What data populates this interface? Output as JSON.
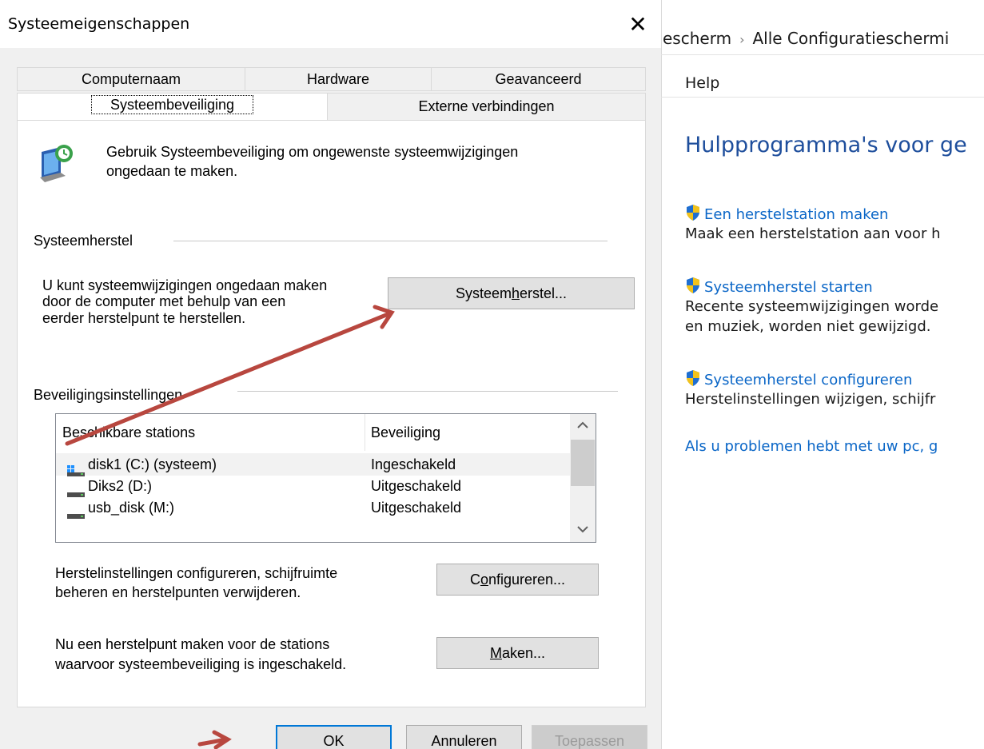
{
  "dialog": {
    "title": "Systeemeigenschappen",
    "close_glyph": "✕",
    "tabs_row1": [
      "Computernaam",
      "Hardware",
      "Geavanceerd"
    ],
    "tabs_row2": [
      "Systeembeveiliging",
      "Externe verbindingen"
    ],
    "intro_line1": "Gebruik Systeembeveiliging om ongewenste systeemwijzigingen",
    "intro_line2": "ongedaan te maken.",
    "restore_group": {
      "label": "Systeemherstel",
      "text_line1": "U kunt systeemwijzigingen ongedaan maken",
      "text_line2": "door de computer met behulp van een",
      "text_line3": "eerder herstelpunt te herstellen.",
      "button_pre": "Systeem",
      "button_accel": "h",
      "button_post": "erstel..."
    },
    "protection_group": {
      "label": "Beveiligingsinstellingen",
      "columns": [
        "Beschikbare stations",
        "Beveiliging"
      ],
      "rows": [
        {
          "name": "disk1 (C:) (systeem)",
          "status": "Ingeschakeld",
          "icon": "system-drive-icon"
        },
        {
          "name": "Diks2 (D:)",
          "status": "Uitgeschakeld",
          "icon": "drive-icon"
        },
        {
          "name": "usb_disk (M:)",
          "status": "Uitgeschakeld",
          "icon": "drive-icon"
        }
      ],
      "configure_text_line1": "Herstelinstellingen configureren, schijfruimte",
      "configure_text_line2": "beheren en herstelpunten verwijderen.",
      "configure_pre": "C",
      "configure_accel": "o",
      "configure_post": "nfigureren...",
      "create_text_line1": "Nu een herstelpunt maken voor de stations",
      "create_text_line2": "waarvoor systeembeveiliging is ingeschakeld.",
      "create_accel": "M",
      "create_post": "aken..."
    },
    "buttons": {
      "ok": "OK",
      "cancel": "Annuleren",
      "apply": "Toepassen"
    }
  },
  "control_panel": {
    "breadcrumb": [
      "escherm",
      "Alle Configuratieschermi"
    ],
    "breadcrumb_sep": "›",
    "menu": "Help",
    "title": "Hulpprogramma's voor ge",
    "items": [
      {
        "link": "Een herstelstation maken",
        "desc": "Maak een herstelstation aan voor h"
      },
      {
        "link": "Systeemherstel starten",
        "desc": "Recente systeemwijzigingen worde",
        "desc2": "en muziek, worden niet gewijzigd."
      },
      {
        "link": "Systeemherstel configureren",
        "desc": "Herstelinstellingen wijzigen, schijfr"
      }
    ],
    "footer_link": "Als u problemen hebt met uw pc, g"
  },
  "colors": {
    "link": "#0a66c7",
    "title": "#1e4e9c",
    "annotation_arrow": "#b8473f",
    "default_button_border": "#0078d7"
  }
}
